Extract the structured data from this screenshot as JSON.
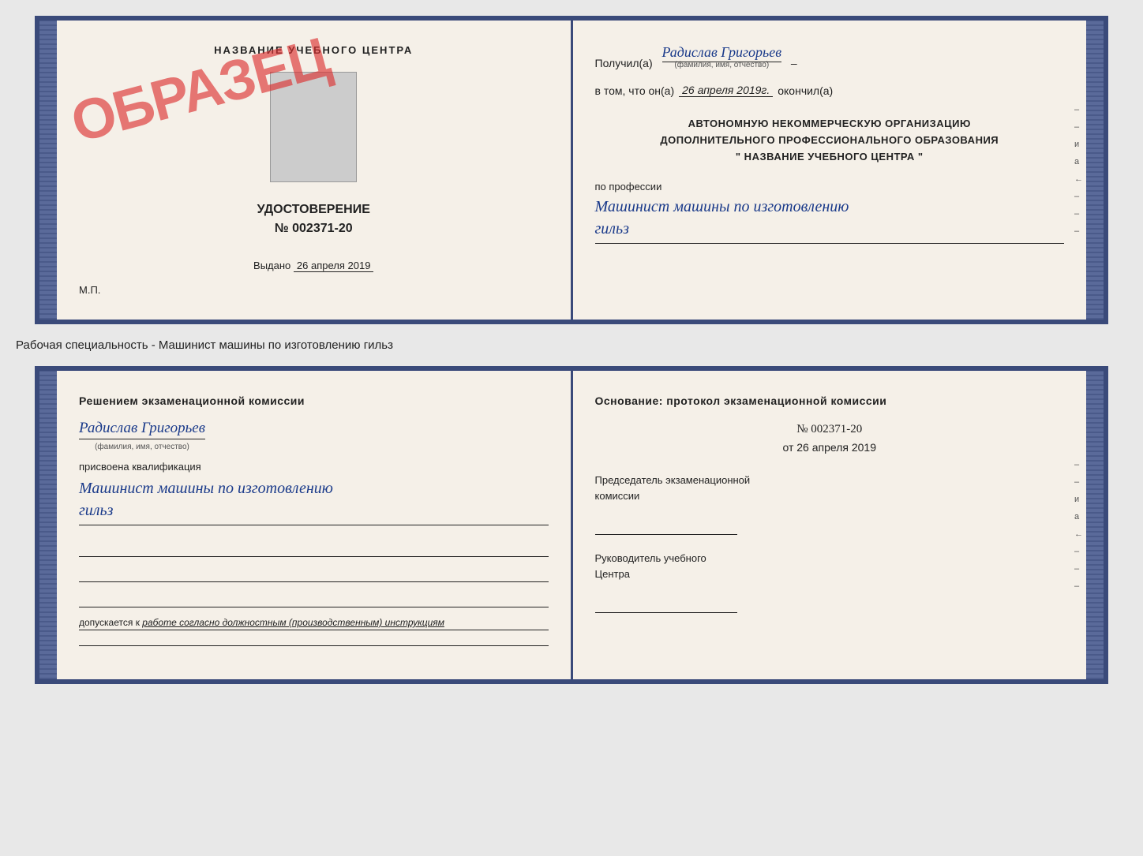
{
  "top_doc": {
    "left": {
      "top_label": "НАЗВАНИЕ УЧЕБНОГО ЦЕНТРА",
      "stamp_text": "ОБРАЗЕЦ",
      "cert_title": "УДОСТОВЕРЕНИЕ",
      "cert_number": "№ 002371-20",
      "issued_label": "Выдано",
      "issued_date": "26 апреля 2019",
      "mp_label": "М.П."
    },
    "right": {
      "received_label": "Получил(а)",
      "recipient_name": "Радислав Григорьев",
      "fio_sublabel": "(фамилия, имя, отчество)",
      "date_prefix": "в том, что он(а)",
      "date_value": "26 апреля 2019г.",
      "date_suffix": "окончил(а)",
      "org_line1": "АВТОНОМНУЮ НЕКОММЕРЧЕСКУЮ ОРГАНИЗАЦИЮ",
      "org_line2": "ДОПОЛНИТЕЛЬНОГО ПРОФЕССИОНАЛЬНОГО ОБРАЗОВАНИЯ",
      "org_line3": "\"   НАЗВАНИЕ УЧЕБНОГО ЦЕНТРА   \"",
      "profession_label": "по профессии",
      "profession_value": "Машинист машины по изготовлению",
      "profession_value2": "гильз"
    }
  },
  "caption": "Рабочая специальность - Машинист машины по изготовлению гильз",
  "bottom_doc": {
    "left": {
      "section_title": "Решением  экзаменационной  комиссии",
      "qualifier_name": "Радислав Григорьев",
      "fio_sublabel": "(фамилия, имя, отчество)",
      "assigned_label": "присвоена квалификация",
      "qualification_value": "Машинист  машины  по  изготовлению",
      "qualification_value2": "гильз",
      "allowed_prefix": "допускается к",
      "allowed_text": " работе согласно должностным (производственным) инструкциям"
    },
    "right": {
      "basis_title": "Основание:  протокол  экзаменационной  комиссии",
      "protocol_number": "№  002371-20",
      "protocol_date_prefix": "от",
      "protocol_date": "26 апреля 2019",
      "chairman_label": "Председатель экзаменационной",
      "chairman_label2": "комиссии",
      "head_label": "Руководитель учебного",
      "head_label2": "Центра"
    }
  },
  "side_marks": [
    "-",
    "–",
    "–",
    "и",
    "а",
    "←",
    "–",
    "–",
    "–"
  ]
}
